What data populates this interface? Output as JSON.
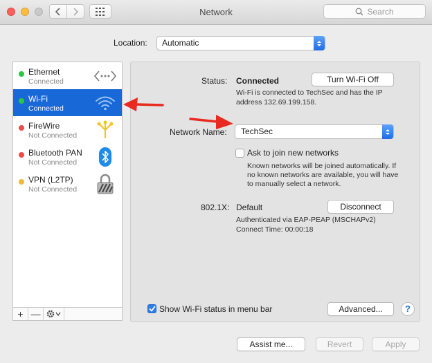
{
  "window": {
    "title": "Network"
  },
  "toolbar": {
    "search_placeholder": "Search",
    "back_icon": "chevron-left-icon",
    "forward_icon": "chevron-right-icon",
    "grid_icon": "grid-icon"
  },
  "location": {
    "label": "Location:",
    "value": "Automatic"
  },
  "services": [
    {
      "name": "Ethernet",
      "status": "Connected",
      "dot_color": "#28c840",
      "icon": "ethernet-icon"
    },
    {
      "name": "Wi-Fi",
      "status": "Connected",
      "dot_color": "#28c840",
      "icon": "wifi-icon"
    },
    {
      "name": "FireWire",
      "status": "Not Connected",
      "dot_color": "#ef4b44",
      "icon": "firewire-icon"
    },
    {
      "name": "Bluetooth PAN",
      "status": "Not Connected",
      "dot_color": "#ef4b44",
      "icon": "bluetooth-icon"
    },
    {
      "name": "VPN (L2TP)",
      "status": "Not Connected",
      "dot_color": "#f5b73a",
      "icon": "vpn-lock-icon"
    }
  ],
  "sidebar_footer": {
    "add": "+",
    "remove": "—",
    "gear": "gear-icon"
  },
  "detail": {
    "status_label": "Status:",
    "status_value": "Connected",
    "turn_off_button": "Turn Wi-Fi Off",
    "status_desc_line1": "Wi-Fi is connected to TechSec and has the IP",
    "status_desc_line2": "address 132.69.199.158.",
    "network_name_label": "Network Name:",
    "network_name_value": "TechSec",
    "ask_join_label": "Ask to join new networks",
    "ask_join_checked": false,
    "ask_join_desc_line1": "Known networks will be joined automatically. If",
    "ask_join_desc_line2": "no known networks are available, you will have",
    "ask_join_desc_line3": "to manually select a network.",
    "dot1x_label": "802.1X:",
    "dot1x_value": "Default",
    "disconnect_button": "Disconnect",
    "auth_line1": "Authenticated via EAP-PEAP (MSCHAPv2)",
    "auth_line2": "Connect Time: 00:00:18",
    "show_status_label": "Show Wi-Fi status in menu bar",
    "show_status_checked": true,
    "advanced_button": "Advanced...",
    "help_button": "?"
  },
  "bottom": {
    "assist_button": "Assist me...",
    "revert_button": "Revert",
    "apply_button": "Apply"
  },
  "colors": {
    "selection": "#1869d7",
    "annotation_arrow": "#e82a20"
  }
}
